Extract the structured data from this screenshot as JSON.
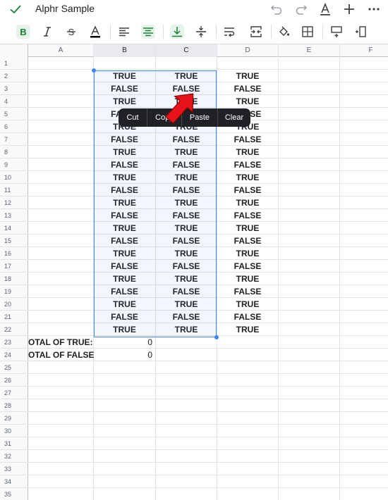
{
  "app": {
    "title": "Alphr Sample"
  },
  "titlebar_icons": [
    "check-icon",
    "undo-icon",
    "redo-icon",
    "text-format-icon",
    "plus-icon",
    "more-icon"
  ],
  "toolbar_icons": [
    "bold-icon",
    "italic-icon",
    "strikethrough-icon",
    "text-color-icon",
    "align-left-icon",
    "align-center-icon",
    "valign-bottom-icon",
    "valign-middle-icon",
    "wrap-text-icon",
    "merge-cells-icon",
    "fill-color-icon",
    "borders-icon",
    "insert-row-icon",
    "insert-column-icon"
  ],
  "colors": {
    "accent": "#1a73e8",
    "active_tool_bg": "#e6f4ea",
    "active_tool_fg": "#188038",
    "menu_bg": "#202124",
    "arrow": "#e8121a"
  },
  "columns": [
    "A",
    "B",
    "C",
    "D",
    "E",
    "F"
  ],
  "rows": [
    "1",
    "2",
    "3",
    "4",
    "5",
    "6",
    "7",
    "8",
    "9",
    "10",
    "11",
    "12",
    "13",
    "14",
    "15",
    "16",
    "17",
    "18",
    "19",
    "20",
    "21",
    "22",
    "23",
    "24",
    "25",
    "26",
    "27",
    "28",
    "29",
    "30",
    "31",
    "32",
    "33",
    "34",
    "35"
  ],
  "sheet": {
    "values_b": [
      "TRUE",
      "FALSE",
      "TRUE",
      "FALSE",
      "TRUE",
      "FALSE",
      "TRUE",
      "FALSE",
      "TRUE",
      "FALSE",
      "TRUE",
      "FALSE",
      "TRUE",
      "FALSE",
      "TRUE",
      "FALSE",
      "TRUE",
      "FALSE",
      "TRUE",
      "FALSE",
      "TRUE"
    ],
    "values_c": [
      "TRUE",
      "FALSE",
      "TRUE",
      "FALSE",
      "TRUE",
      "FALSE",
      "TRUE",
      "FALSE",
      "TRUE",
      "FALSE",
      "TRUE",
      "FALSE",
      "TRUE",
      "FALSE",
      "TRUE",
      "FALSE",
      "TRUE",
      "FALSE",
      "TRUE",
      "FALSE",
      "TRUE"
    ],
    "values_d": [
      "TRUE",
      "FALSE",
      "TRUE",
      "FALSE",
      "TRUE",
      "FALSE",
      "TRUE",
      "FALSE",
      "TRUE",
      "FALSE",
      "TRUE",
      "FALSE",
      "TRUE",
      "FALSE",
      "TRUE",
      "FALSE",
      "TRUE",
      "FALSE",
      "TRUE",
      "FALSE",
      "TRUE"
    ],
    "total_true_label": "OTAL OF TRUE:",
    "total_false_label": "OTAL OF FALSE",
    "total_true_value": "0",
    "total_false_value": "0"
  },
  "context_menu": {
    "cut": "Cut",
    "copy": "Copy",
    "paste": "Paste",
    "clear": "Clear"
  }
}
